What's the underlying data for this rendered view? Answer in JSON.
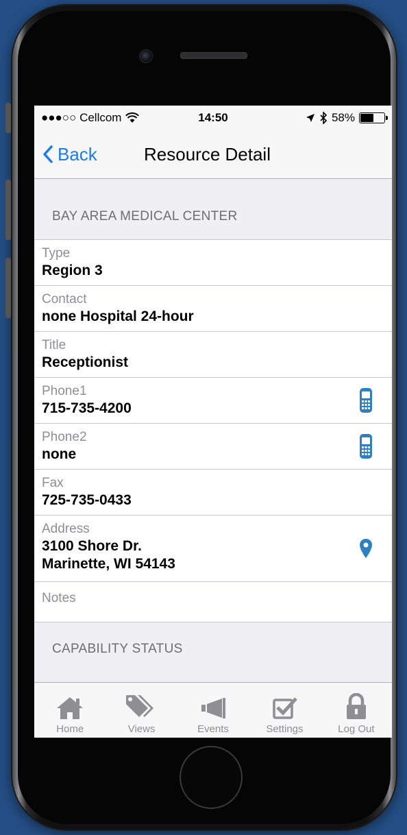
{
  "status_bar": {
    "carrier": "●●●○○ Cellcom",
    "time": "14:50",
    "battery_percent": "58%",
    "battery_level": 0.58
  },
  "nav": {
    "back_label": "Back",
    "title": "Resource Detail"
  },
  "resource": {
    "section_title": "BAY AREA MEDICAL CENTER",
    "fields": [
      {
        "label": "Type",
        "value": "Region 3"
      },
      {
        "label": "Contact",
        "value": "none Hospital 24-hour"
      },
      {
        "label": "Title",
        "value": "Receptionist"
      },
      {
        "label": "Phone1",
        "value": "715-735-4200",
        "icon": "mobile-phone-icon"
      },
      {
        "label": "Phone2",
        "value": "none",
        "icon": "mobile-phone-icon"
      },
      {
        "label": "Fax",
        "value": "725-735-0433"
      },
      {
        "label": "Address",
        "value_line1": "3100 Shore Dr.",
        "value_line2": "Marinette, WI 54143",
        "icon": "map-pin-icon"
      },
      {
        "label": "Notes",
        "value": ""
      }
    ]
  },
  "capability": {
    "section_title": "CAPABILITY STATUS"
  },
  "tabs": [
    {
      "label": "Home",
      "icon": "home-icon"
    },
    {
      "label": "Views",
      "icon": "tags-icon"
    },
    {
      "label": "Events",
      "icon": "megaphone-icon"
    },
    {
      "label": "Settings",
      "icon": "checkbox-icon"
    },
    {
      "label": "Log Out",
      "icon": "lock-icon"
    }
  ],
  "colors": {
    "background": "#244f86",
    "accent": "#1a7cf0",
    "icon_blue": "#2f80c2",
    "tab_gray": "#8e8e93"
  }
}
